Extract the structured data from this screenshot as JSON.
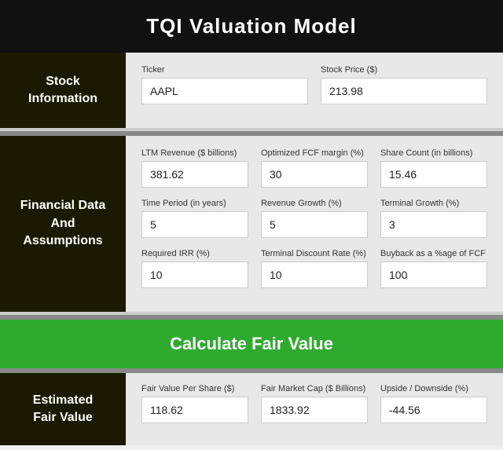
{
  "header": {
    "title_part1": "TQI Valuation Model",
    "title_accent": ""
  },
  "stock_section": {
    "label": "Stock\nInformation",
    "fields": [
      {
        "label": "Ticker",
        "value": "AAPL",
        "name": "ticker-input"
      },
      {
        "label": "Stock Price ($)",
        "value": "213.98",
        "name": "stock-price-input"
      }
    ]
  },
  "financial_section": {
    "label": "Financial Data\nAnd\nAssumptions",
    "rows": [
      [
        {
          "label": "LTM Revenue ($ billions)",
          "value": "381.62",
          "name": "ltm-revenue-input"
        },
        {
          "label": "Optimized FCF margin (%)",
          "value": "30",
          "name": "fcf-margin-input"
        },
        {
          "label": "Share Count (in billions)",
          "value": "15.46",
          "name": "share-count-input"
        }
      ],
      [
        {
          "label": "Time Period (in years)",
          "value": "5",
          "name": "time-period-input"
        },
        {
          "label": "Revenue Growth (%)",
          "value": "5",
          "name": "revenue-growth-input"
        },
        {
          "label": "Terminal Growth (%)",
          "value": "3",
          "name": "terminal-growth-input"
        }
      ],
      [
        {
          "label": "Required IRR (%)",
          "value": "10",
          "name": "required-irr-input"
        },
        {
          "label": "Terminal Discount Rate (%)",
          "value": "10",
          "name": "terminal-discount-input"
        },
        {
          "label": "Buyback as a %age of FCF",
          "value": "100",
          "name": "buyback-input"
        }
      ]
    ]
  },
  "calculate": {
    "label": "Calculate Fair Value"
  },
  "result_section": {
    "label": "Estimated\nFair Value",
    "fields": [
      {
        "label": "Fair Value Per Share ($)",
        "value": "118.62",
        "name": "fair-value-per-share-input"
      },
      {
        "label": "Fair Market Cap ($ Billions)",
        "value": "1833.92",
        "name": "fair-market-cap-input"
      },
      {
        "label": "Upside / Downside (%)",
        "value": "-44.56",
        "name": "upside-downside-input"
      }
    ]
  }
}
